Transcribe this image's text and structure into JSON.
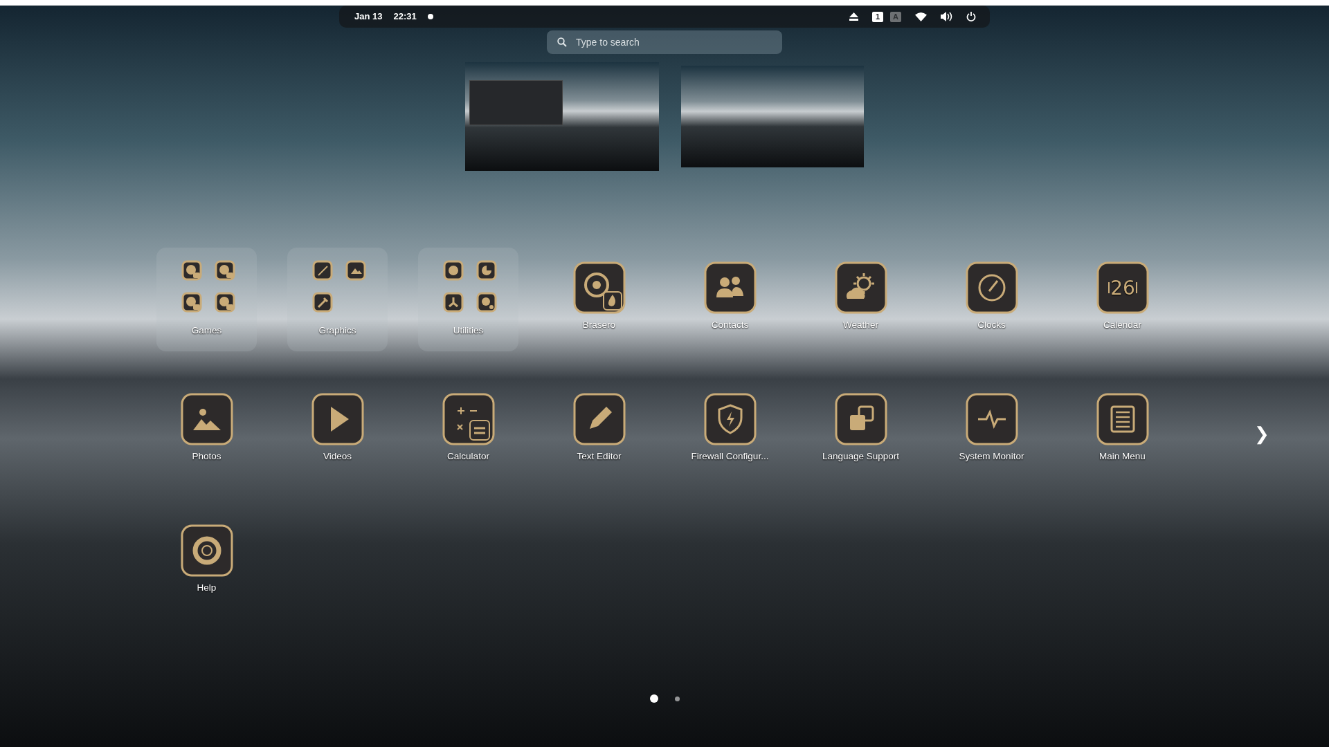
{
  "top_bar": {
    "date": "Jan 13",
    "time": "22:31",
    "notification_dot": true,
    "input_sources": [
      {
        "label": "1",
        "selected": true
      },
      {
        "label": "A",
        "selected": false
      }
    ]
  },
  "search": {
    "placeholder": "Type to search"
  },
  "workspaces": [
    {
      "has_window": true
    },
    {
      "has_window": false
    }
  ],
  "apps": [
    {
      "kind": "folder",
      "label": "Games"
    },
    {
      "kind": "folder",
      "label": "Graphics"
    },
    {
      "kind": "folder",
      "label": "Utilities"
    },
    {
      "kind": "app",
      "label": "Brasero"
    },
    {
      "kind": "app",
      "label": "Contacts"
    },
    {
      "kind": "app",
      "label": "Weather"
    },
    {
      "kind": "app",
      "label": "Clocks"
    },
    {
      "kind": "app",
      "label": "Calendar",
      "icon_text": "26"
    },
    {
      "kind": "app",
      "label": "Photos"
    },
    {
      "kind": "app",
      "label": "Videos"
    },
    {
      "kind": "app",
      "label": "Calculator"
    },
    {
      "kind": "app",
      "label": "Text Editor"
    },
    {
      "kind": "app",
      "label": "Firewall Configur..."
    },
    {
      "kind": "app",
      "label": "Language Support"
    },
    {
      "kind": "app",
      "label": "System Monitor"
    },
    {
      "kind": "app",
      "label": "Main Menu"
    },
    {
      "kind": "app",
      "label": "Help"
    }
  ],
  "next_page_arrow": "❯",
  "pages": [
    {
      "selected": true
    },
    {
      "selected": false
    }
  ]
}
